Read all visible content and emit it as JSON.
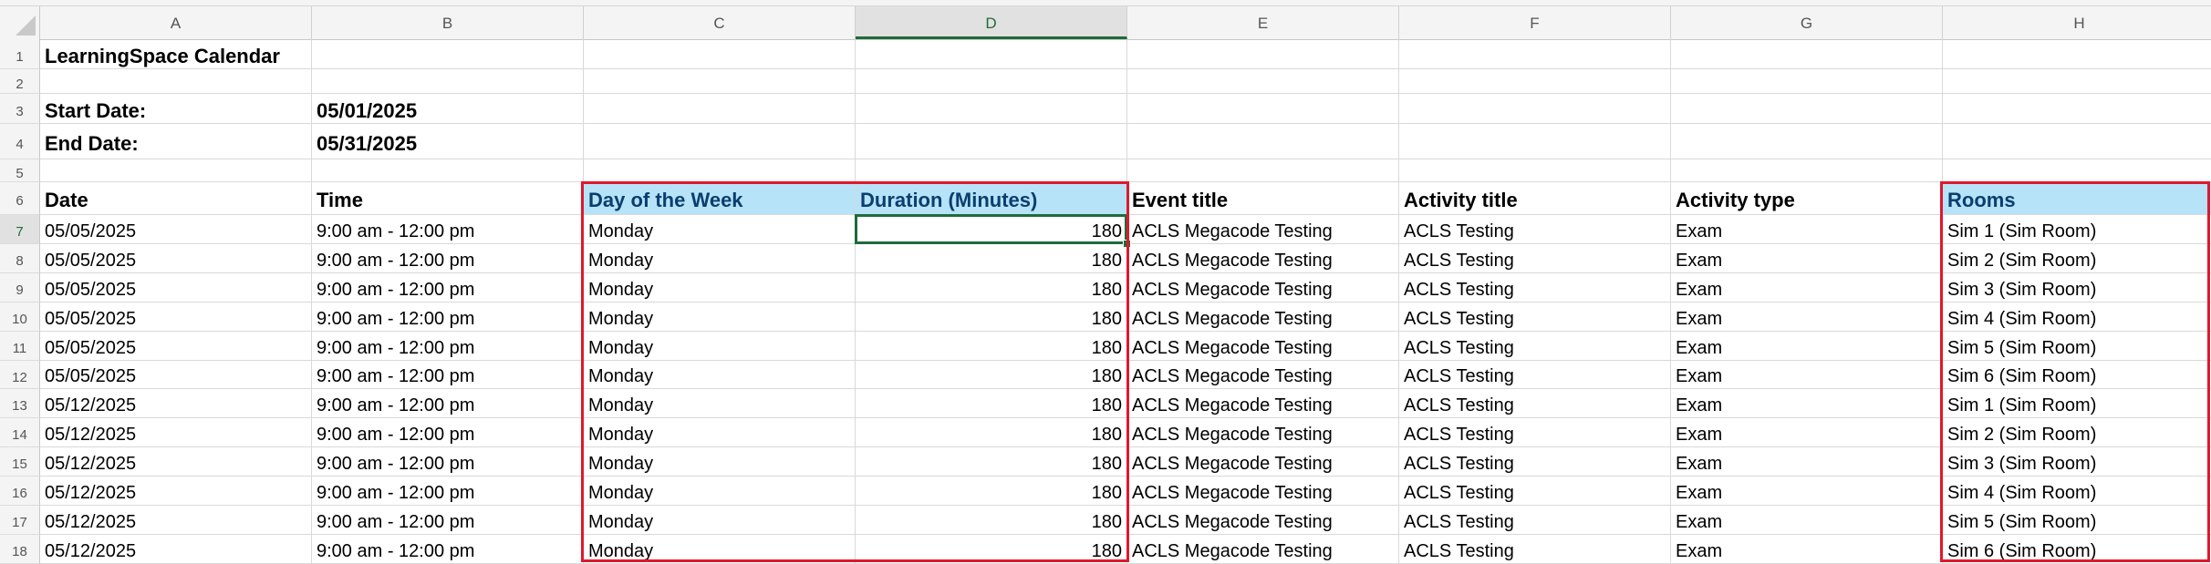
{
  "columns": [
    "A",
    "B",
    "C",
    "D",
    "E",
    "F",
    "G",
    "H"
  ],
  "active_column": "D",
  "active_row": 7,
  "row_numbers": [
    1,
    2,
    3,
    4,
    5,
    6,
    7,
    8,
    9,
    10,
    11,
    12,
    13,
    14,
    15,
    16,
    17,
    18
  ],
  "sheet": {
    "title": "LearningSpace Calendar",
    "start_label": "Start Date:",
    "start_value": "05/01/2025",
    "end_label": "End Date:",
    "end_value": "05/31/2025"
  },
  "headers": [
    "Date",
    "Time",
    "Day of the Week",
    "Duration (Minutes)",
    "Event title",
    "Activity title",
    "Activity type",
    "Rooms"
  ],
  "highlighted_headers": [
    2,
    3,
    7
  ],
  "rows": [
    [
      "05/05/2025",
      "9:00 am - 12:00 pm",
      "Monday",
      "180",
      "ACLS Megacode Testing",
      "ACLS Testing",
      "Exam",
      "Sim 1 (Sim Room)"
    ],
    [
      "05/05/2025",
      "9:00 am - 12:00 pm",
      "Monday",
      "180",
      "ACLS Megacode Testing",
      "ACLS Testing",
      "Exam",
      "Sim 2 (Sim Room)"
    ],
    [
      "05/05/2025",
      "9:00 am - 12:00 pm",
      "Monday",
      "180",
      "ACLS Megacode Testing",
      "ACLS Testing",
      "Exam",
      "Sim 3 (Sim Room)"
    ],
    [
      "05/05/2025",
      "9:00 am - 12:00 pm",
      "Monday",
      "180",
      "ACLS Megacode Testing",
      "ACLS Testing",
      "Exam",
      "Sim 4 (Sim Room)"
    ],
    [
      "05/05/2025",
      "9:00 am - 12:00 pm",
      "Monday",
      "180",
      "ACLS Megacode Testing",
      "ACLS Testing",
      "Exam",
      "Sim 5 (Sim Room)"
    ],
    [
      "05/05/2025",
      "9:00 am - 12:00 pm",
      "Monday",
      "180",
      "ACLS Megacode Testing",
      "ACLS Testing",
      "Exam",
      "Sim 6 (Sim Room)"
    ],
    [
      "05/12/2025",
      "9:00 am - 12:00 pm",
      "Monday",
      "180",
      "ACLS Megacode Testing",
      "ACLS Testing",
      "Exam",
      "Sim 1 (Sim Room)"
    ],
    [
      "05/12/2025",
      "9:00 am - 12:00 pm",
      "Monday",
      "180",
      "ACLS Megacode Testing",
      "ACLS Testing",
      "Exam",
      "Sim 2 (Sim Room)"
    ],
    [
      "05/12/2025",
      "9:00 am - 12:00 pm",
      "Monday",
      "180",
      "ACLS Megacode Testing",
      "ACLS Testing",
      "Exam",
      "Sim 3 (Sim Room)"
    ],
    [
      "05/12/2025",
      "9:00 am - 12:00 pm",
      "Monday",
      "180",
      "ACLS Megacode Testing",
      "ACLS Testing",
      "Exam",
      "Sim 4 (Sim Room)"
    ],
    [
      "05/12/2025",
      "9:00 am - 12:00 pm",
      "Monday",
      "180",
      "ACLS Megacode Testing",
      "ACLS Testing",
      "Exam",
      "Sim 5 (Sim Room)"
    ],
    [
      "05/12/2025",
      "9:00 am - 12:00 pm",
      "Monday",
      "180",
      "ACLS Megacode Testing",
      "ACLS Testing",
      "Exam",
      "Sim 6 (Sim Room)"
    ]
  ],
  "colors": {
    "header_highlight": "#b6e3f7",
    "annotation_box": "#e0182d",
    "selection": "#1e6b3a"
  }
}
